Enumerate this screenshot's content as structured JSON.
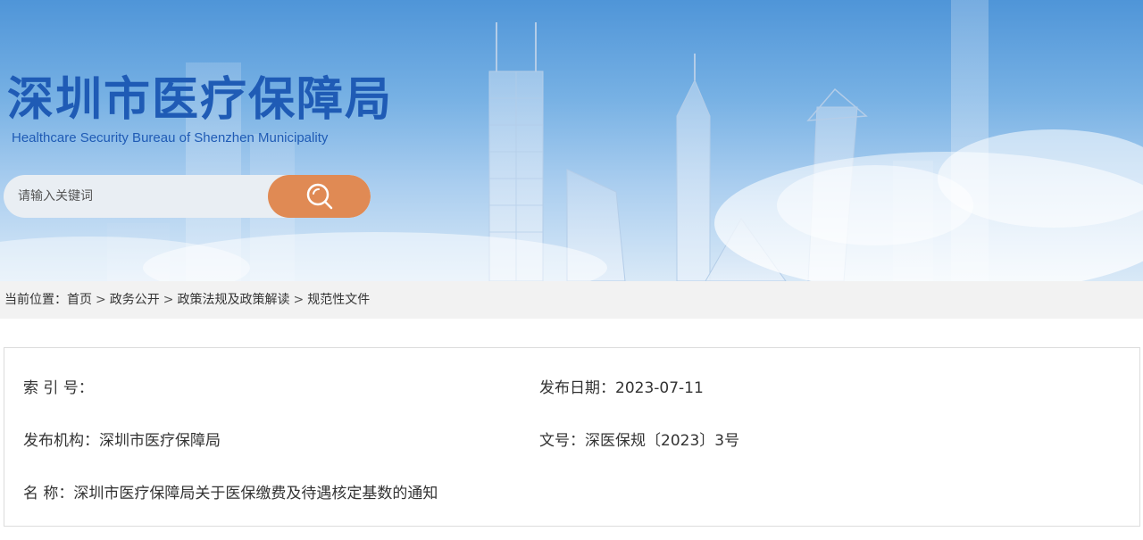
{
  "header": {
    "title": "深圳市医疗保障局",
    "subtitle": "Healthcare Security Bureau of Shenzhen Municipality",
    "brand_color": "#1f5bb5"
  },
  "search": {
    "placeholder": "请输入关键词",
    "button_icon": "search-icon",
    "button_color": "#e08a54"
  },
  "breadcrumb": {
    "prefix": "当前位置：",
    "items": [
      "首页",
      "政务公开",
      "政策法规及政策解读",
      "规范性文件"
    ],
    "separator": ">"
  },
  "document_info": {
    "index_label": "索 引 号：",
    "index_value": "",
    "date_label": "发布日期：",
    "date_value": "2023-07-11",
    "publisher_label": "发布机构：",
    "publisher_value": "深圳市医疗保障局",
    "docno_label": "文号：",
    "docno_value": "深医保规〔2023〕3号",
    "name_label": "名 称：",
    "name_value": "深圳市医疗保障局关于医保缴费及待遇核定基数的通知"
  }
}
